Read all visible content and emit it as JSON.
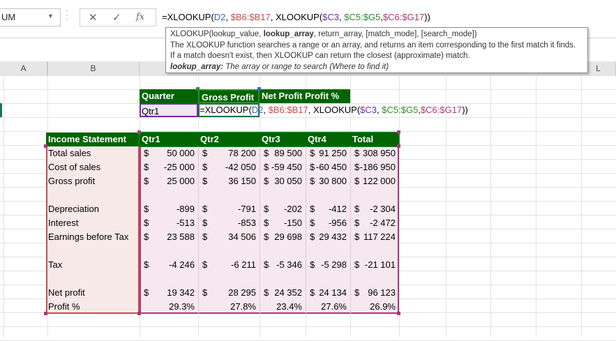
{
  "formula_bar": {
    "name_box": "UM",
    "cancel_icon": "✕",
    "enter_icon": "✓",
    "fx_icon": "fx",
    "formula_parts": [
      {
        "text": "=XLOOKUP(",
        "color": "black"
      },
      {
        "text": "D2",
        "color": "blue"
      },
      {
        "text": ", ",
        "color": "black"
      },
      {
        "text": "$B6:$B17",
        "color": "red"
      },
      {
        "text": ", XLOOKUP(",
        "color": "black"
      },
      {
        "text": "$C3",
        "color": "purple"
      },
      {
        "text": ", ",
        "color": "black"
      },
      {
        "text": "$C5:$G5",
        "color": "green"
      },
      {
        "text": ",",
        "color": "black"
      },
      {
        "text": "$C6:$G17",
        "color": "pink"
      },
      {
        "text": "))",
        "color": "black"
      }
    ]
  },
  "tooltip": {
    "signature_start": "XLOOKUP(lookup_value, ",
    "signature_bold": "lookup_array",
    "signature_end": ", return_array, [match_mode], [search_mode])",
    "line2": "The XLOOKUP function searches a range or an array, and returns an item corresponding to the first match it finds.",
    "line3": "If a match doesn't exist, then XLOOKUP can return the closest (approximate) match.",
    "arg_name": "lookup_array:",
    "arg_desc": " The array or range to search (Where to find it)"
  },
  "columns": [
    "A",
    "B",
    "L"
  ],
  "lookup_table": {
    "headers": [
      "Quarter",
      "Gross Profit",
      "Net Profit Profit %"
    ],
    "quarter_value": "Qtr1",
    "editing_formula": "=XLOOKUP(D2, $B6:$B17, XLOOKUP($C3, $C5:$G5,$C6:$G17))"
  },
  "income_statement": {
    "header_label": "Income Statement",
    "quarters": [
      "Qtr1",
      "Qtr2",
      "Qtr3",
      "Qtr4",
      "Total"
    ],
    "rows": [
      {
        "label": "Total sales",
        "values": [
          "50 000",
          "78 200",
          "89 500",
          "91 250",
          "308 950"
        ]
      },
      {
        "label": "Cost of sales",
        "values": [
          "-25 000",
          "-42 050",
          "-59 450",
          "-60 450",
          "-186 950"
        ]
      },
      {
        "label": "Gross profit",
        "values": [
          "25 000",
          "36 150",
          "30 050",
          "30 800",
          "122 000"
        ]
      },
      {
        "label": "",
        "values": [
          "",
          "",
          "",
          "",
          ""
        ]
      },
      {
        "label": "Depreciation",
        "values": [
          "-899",
          "-791",
          "-202",
          "-412",
          "-2 304"
        ]
      },
      {
        "label": "Interest",
        "values": [
          "-513",
          "-853",
          "-150",
          "-956",
          "-2 472"
        ]
      },
      {
        "label": "Earnings before Tax",
        "values": [
          "23 588",
          "34 506",
          "29 698",
          "29 432",
          "117 224"
        ]
      },
      {
        "label": "",
        "values": [
          "",
          "",
          "",
          "",
          ""
        ]
      },
      {
        "label": "Tax",
        "values": [
          "-4 246",
          "-6 211",
          "-5 346",
          "-5 298",
          "-21 101"
        ]
      },
      {
        "label": "",
        "values": [
          "",
          "",
          "",
          "",
          ""
        ]
      },
      {
        "label": "Net profit",
        "values": [
          "19 342",
          "28 295",
          "24 352",
          "24 134",
          "96 123"
        ]
      },
      {
        "label": "Profit %",
        "values": [
          "29.3%",
          "27.8%",
          "23.4%",
          "27.6%",
          "26.9%"
        ],
        "no_dollar": true
      }
    ]
  },
  "currency_symbol": "$",
  "colors": {
    "header_green": "#006400",
    "ref_red": "#c0504d",
    "ref_blue": "#3b64c4",
    "ref_green": "#2e8b2e",
    "ref_pink": "#b0357a",
    "ref_purple": "#7030a0"
  }
}
